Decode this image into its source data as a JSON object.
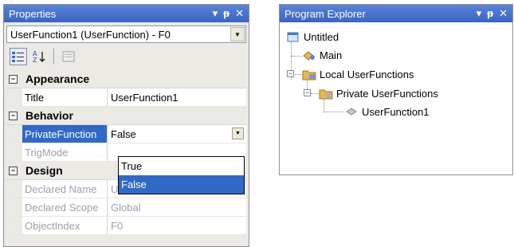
{
  "properties_panel": {
    "title": "Properties",
    "pin_glyph": "▾ ⨆ ✕",
    "object_selector": "UserFunction1 (UserFunction) - F0",
    "categories": [
      {
        "name": "Appearance",
        "props": [
          {
            "name": "Title",
            "value": "UserFunction1"
          }
        ]
      },
      {
        "name": "Behavior",
        "props": [
          {
            "name": "PrivateFunction",
            "value": "False"
          },
          {
            "name": "TrigMode",
            "value": ""
          }
        ]
      },
      {
        "name": "Design",
        "props": [
          {
            "name": "Declared Name",
            "value": "UserFunction"
          },
          {
            "name": "Declared Scope",
            "value": "Global"
          },
          {
            "name": "ObjectIndex",
            "value": "F0"
          }
        ]
      }
    ],
    "dropdown_options": [
      "True",
      "False"
    ],
    "dropdown_selected": "False"
  },
  "explorer_panel": {
    "title": "Program Explorer",
    "tree": {
      "root": "Untitled",
      "main": "Main",
      "local": "Local UserFunctions",
      "private": "Private UserFunctions",
      "function": "UserFunction1"
    }
  },
  "colors": {
    "titlebar": "#3a64c0",
    "selection": "#3169c6",
    "folder": "#e8b84a"
  }
}
